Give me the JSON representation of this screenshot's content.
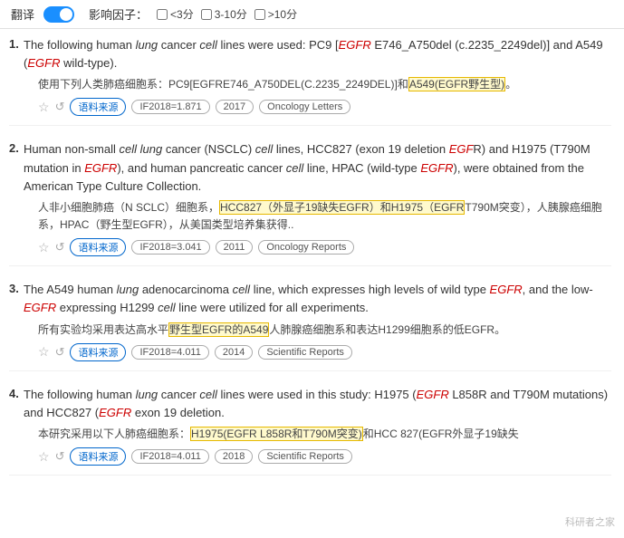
{
  "topbar": {
    "translate_label": "翻译",
    "impact_label": "影响因子：",
    "filters": [
      {
        "label": "<3分",
        "checked": false
      },
      {
        "label": "3-10分",
        "checked": false
      },
      {
        " label": ">10分",
        "checked": false
      }
    ]
  },
  "results": [
    {
      "number": "1.",
      "en_parts": [
        {
          "text": "The following human ",
          "style": "normal"
        },
        {
          "text": "lung",
          "style": "italic"
        },
        {
          "text": " cancer ",
          "style": "normal"
        },
        {
          "text": "cell",
          "style": "italic"
        },
        {
          "text": " lines were used: PC9 [",
          "style": "normal"
        },
        {
          "text": "EGFR",
          "style": "italic-red"
        },
        {
          "text": " E746_A750del (c.2235_2249del)] and A549 (",
          "style": "normal"
        },
        {
          "text": "EGFR",
          "style": "italic-red"
        },
        {
          "text": " wild-type).",
          "style": "normal"
        }
      ],
      "cn": "使用下列人类肺癌细胞系：PC9[EGFRE746_A750DEL(C.2235_2249DEL)]和",
      "cn_highlight": "A549(EGFR野生型)。",
      "cn_after": "",
      "meta": {
        "if": "IF2018=1.871",
        "year": "2017",
        "journal": "Oncology Letters"
      }
    },
    {
      "number": "2.",
      "en_parts": [
        {
          "text": "Human non-small ",
          "style": "normal"
        },
        {
          "text": "cell lung",
          "style": "italic"
        },
        {
          "text": " cancer (NSCLC) ",
          "style": "normal"
        },
        {
          "text": "cell",
          "style": "italic"
        },
        {
          "text": " lines, HCC827 (exon 19 deletion ",
          "style": "normal"
        },
        {
          "text": "EGF",
          "style": "italic-red"
        },
        {
          "text": "R) and H1975 (T790M mutation in ",
          "style": "normal"
        },
        {
          "text": "EGFR",
          "style": "italic-red"
        },
        {
          "text": "), and human pancreatic cancer ",
          "style": "normal"
        },
        {
          "text": "cell",
          "style": "italic"
        },
        {
          "text": " line, HPAC (wild-type ",
          "style": "normal"
        },
        {
          "text": "EGFR",
          "style": "italic-red"
        },
        {
          "text": "), were obtained from the American Type Culture Collection.",
          "style": "normal"
        }
      ],
      "cn": "人非小细胞肺癌（N SCLC）细胞系，",
      "cn_highlight": "HCC827（外显子19缺失EGFR）和H1975（EGFR",
      "cn_after": "T790M突变），人胰腺癌细胞系，HPAC（野生型EGFR），从美国类型培养集获得..",
      "meta": {
        "if": "IF2018=3.041",
        "year": "2011",
        "journal": "Oncology Reports"
      }
    },
    {
      "number": "3.",
      "en_parts": [
        {
          "text": "The A549 human ",
          "style": "normal"
        },
        {
          "text": "lung",
          "style": "italic"
        },
        {
          "text": " adenocarcinoma ",
          "style": "normal"
        },
        {
          "text": "cell",
          "style": "italic"
        },
        {
          "text": " line, which expresses high levels of wild type ",
          "style": "normal"
        },
        {
          "text": "EGFR",
          "style": "italic-red"
        },
        {
          "text": ", and the low-",
          "style": "normal"
        },
        {
          "text": "EGFR",
          "style": "italic-red"
        },
        {
          "text": " expressing H1299 ",
          "style": "normal"
        },
        {
          "text": "cell",
          "style": "italic"
        },
        {
          "text": " line were utilized for all experiments.",
          "style": "normal"
        }
      ],
      "cn": "所有实验均采用表达高水平",
      "cn_highlight": "野生型EGFR的A549",
      "cn_after": "人肺腺癌细胞系和表达H1299细胞系的低EGFR。",
      "meta": {
        "if": "IF2018=4.011",
        "year": "2014",
        "journal": "Scientific Reports"
      }
    },
    {
      "number": "4.",
      "en_parts": [
        {
          "text": "The following human ",
          "style": "normal"
        },
        {
          "text": "lung",
          "style": "italic"
        },
        {
          "text": " cancer ",
          "style": "normal"
        },
        {
          "text": "cell",
          "style": "italic"
        },
        {
          "text": " lines were used in this study: H1975 (",
          "style": "normal"
        },
        {
          "text": "EGFR",
          "style": "italic-red"
        },
        {
          "text": " L858R and T790M mutations) and HCC827 (",
          "style": "normal"
        },
        {
          "text": "EGFR",
          "style": "italic-red"
        },
        {
          "text": " exon 19 deletion.",
          "style": "normal"
        }
      ],
      "cn": "本研究采用以下人肺癌细胞系：",
      "cn_highlight": "H1975(EGFR L858R和T790M突变)",
      "cn_after": "和HCC 827(EGFR外显子19缺失",
      "meta": {
        "if": "IF2018=4.011",
        "year": "2018",
        "journal": "Scientific Reports"
      }
    }
  ],
  "watermark": "科研者之家"
}
